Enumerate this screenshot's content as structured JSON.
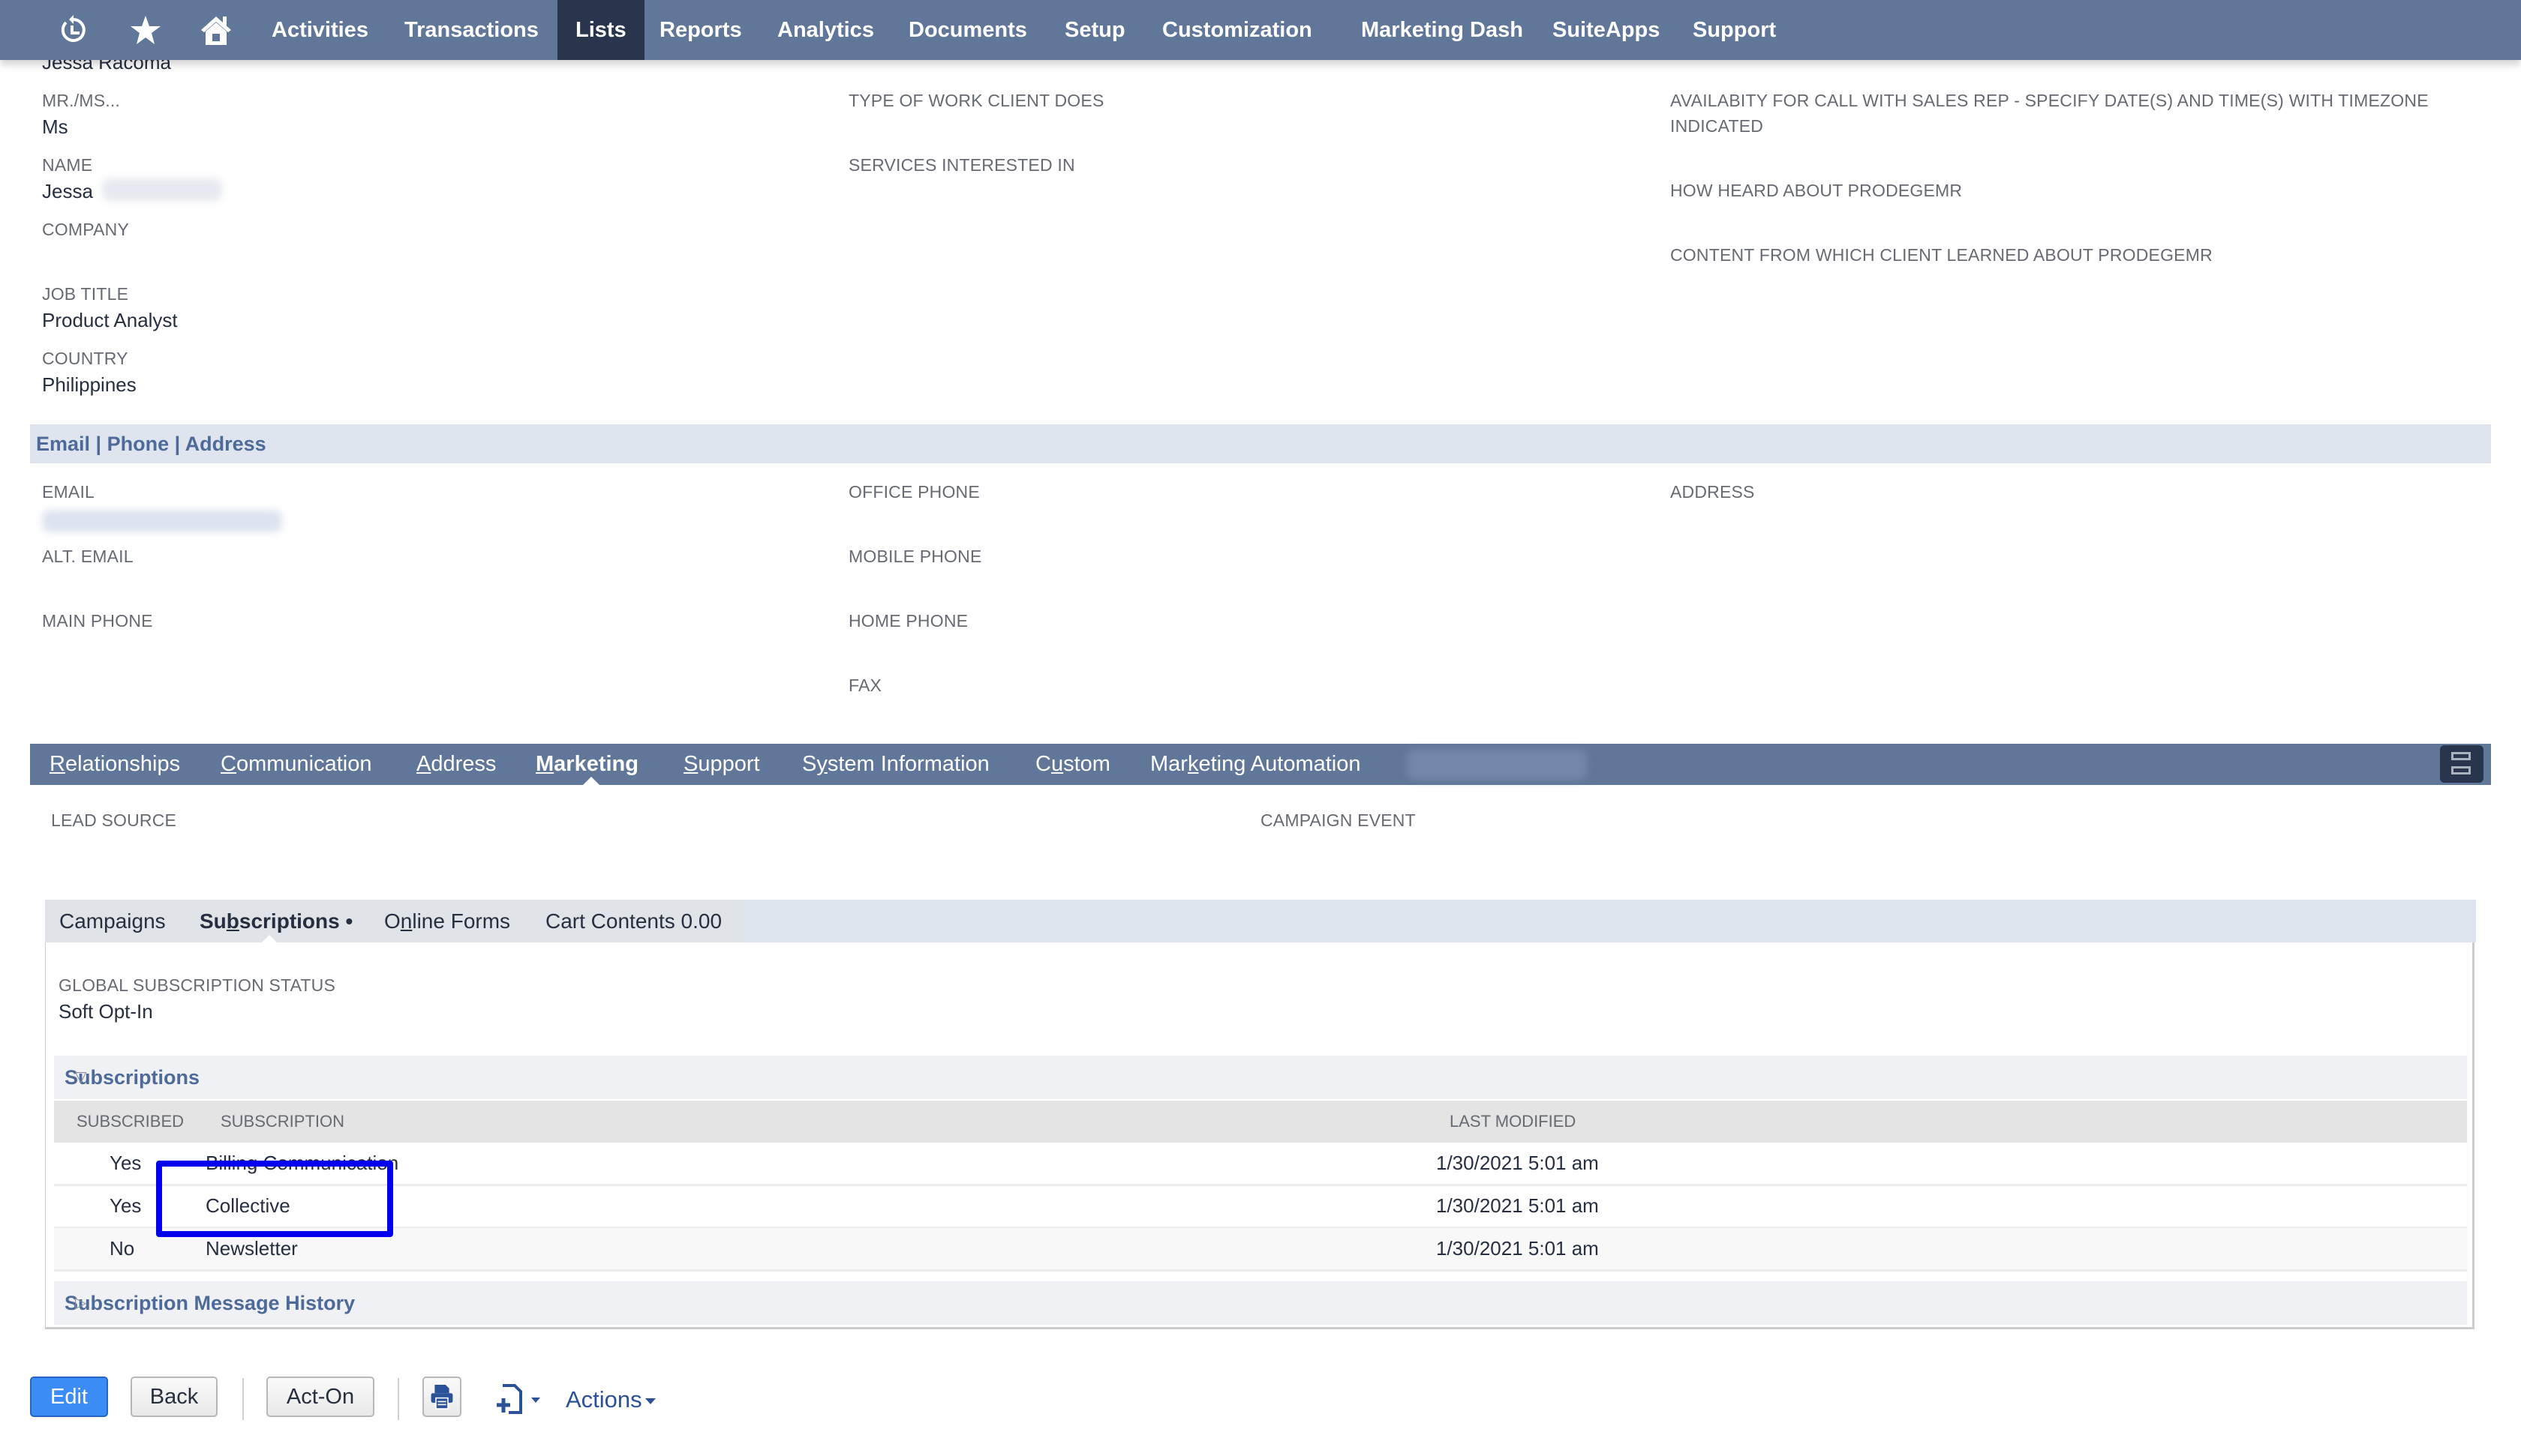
{
  "nav": {
    "icons": [
      "recent-records-icon",
      "star-icon",
      "home-icon"
    ],
    "items": [
      "Activities",
      "Transactions",
      "Lists",
      "Reports",
      "Analytics",
      "Documents",
      "Setup",
      "Customization",
      "Marketing Dash",
      "SuiteApps",
      "Support"
    ],
    "active": "Lists"
  },
  "record": {
    "header_name": "Jessa Racoma",
    "col1": [
      {
        "label": "MR./MS...",
        "value": "Ms"
      },
      {
        "label": "NAME",
        "value": "Jessa"
      },
      {
        "label": "COMPANY",
        "value": ""
      },
      {
        "label": "JOB TITLE",
        "value": "Product Analyst"
      },
      {
        "label": "COUNTRY",
        "value": "Philippines"
      }
    ],
    "col2": [
      {
        "label": "TYPE OF WORK CLIENT DOES",
        "value": ""
      },
      {
        "label": "SERVICES INTERESTED IN",
        "value": ""
      }
    ],
    "col3": [
      {
        "label": "AVAILABITY FOR CALL WITH SALES REP - SPECIFY DATE(S) AND TIME(S) WITH TIMEZONE INDICATED",
        "value": ""
      },
      {
        "label": "HOW HEARD ABOUT PRODEGEMR",
        "value": ""
      },
      {
        "label": "CONTENT FROM WHICH CLIENT LEARNED ABOUT PRODEGEMR",
        "value": ""
      }
    ]
  },
  "contact_section": {
    "title": "Email | Phone | Address",
    "col1": [
      {
        "label": "EMAIL",
        "value": ""
      },
      {
        "label": "ALT. EMAIL",
        "value": ""
      },
      {
        "label": "MAIN PHONE",
        "value": ""
      }
    ],
    "col2": [
      {
        "label": "OFFICE PHONE",
        "value": ""
      },
      {
        "label": "MOBILE PHONE",
        "value": ""
      },
      {
        "label": "HOME PHONE",
        "value": ""
      },
      {
        "label": "FAX",
        "value": ""
      }
    ],
    "col3": [
      {
        "label": "ADDRESS",
        "value": ""
      }
    ]
  },
  "tabs": {
    "items": [
      {
        "pre": "",
        "u": "R",
        "post": "elationships"
      },
      {
        "pre": "",
        "u": "C",
        "post": "ommunication"
      },
      {
        "pre": "",
        "u": "A",
        "post": "ddress"
      },
      {
        "pre": "",
        "u": "M",
        "post": "arketing"
      },
      {
        "pre": "",
        "u": "S",
        "post": "upport"
      },
      {
        "pre": "S",
        "u": "y",
        "post": "stem Information"
      },
      {
        "pre": "C",
        "u": "u",
        "post": "stom"
      },
      {
        "pre": "Mar",
        "u": "k",
        "post": "eting Automation"
      }
    ],
    "active_index": 3
  },
  "marketing": {
    "lead_source_label": "LEAD SOURCE",
    "campaign_event_label": "CAMPAIGN EVENT",
    "subtabs": [
      {
        "pre": "Campai",
        "u": "g",
        "post": "ns"
      },
      {
        "pre": "Su",
        "u": "b",
        "post": "scriptions •"
      },
      {
        "pre": "O",
        "u": "n",
        "post": "line Forms"
      },
      {
        "pre": "Cart Contents 0.00",
        "u": "",
        "post": ""
      }
    ],
    "active_subtab": 1,
    "global_status_label": "GLOBAL SUBSCRIPTION STATUS",
    "global_status_value": "Soft Opt-In",
    "subscriptions_group": "Subscriptions",
    "history_group": "Subscription Message History",
    "table": {
      "columns": [
        "SUBSCRIBED",
        "SUBSCRIPTION",
        "LAST MODIFIED"
      ],
      "rows": [
        {
          "subscribed": "Yes",
          "subscription": "Billing Communication",
          "last_modified": "1/30/2021 5:01 am"
        },
        {
          "subscribed": "Yes",
          "subscription": "Collective",
          "last_modified": "1/30/2021 5:01 am"
        },
        {
          "subscribed": "No",
          "subscription": "Newsletter",
          "last_modified": "1/30/2021 5:01 am"
        }
      ]
    },
    "highlighted_row": 1
  },
  "buttons": {
    "edit": "Edit",
    "back": "Back",
    "act_on": "Act-On",
    "actions": "Actions"
  },
  "colors": {
    "nav_bg": "#607799",
    "nav_active": "#28354d",
    "primary_button": "#3b8df5",
    "highlight_box": "#0000ee",
    "link_blue": "#4d6a99"
  }
}
